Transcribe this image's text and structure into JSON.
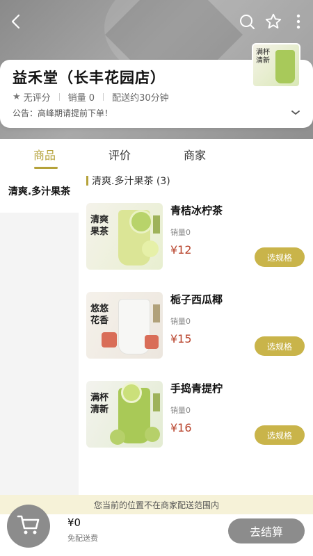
{
  "header": {
    "back_icon": "back-arrow-icon",
    "search_icon": "search-icon",
    "favorite_icon": "star-outline-icon",
    "more_icon": "more-vertical-icon",
    "logo_text": "满杯清新"
  },
  "store": {
    "name": "益禾堂（长丰花园店）",
    "rating": "无评分",
    "sales": "销量 0",
    "delivery_time": "配送约30分钟",
    "notice": "公告：高峰期请提前下单！"
  },
  "tabs": [
    {
      "label": "商品",
      "active": true
    },
    {
      "label": "评价",
      "active": false
    },
    {
      "label": "商家",
      "active": false
    }
  ],
  "sidebar": {
    "items": [
      {
        "label": "清爽.多汁果茶"
      }
    ]
  },
  "category": {
    "title": "清爽.多汁果茶 (3)"
  },
  "products": [
    {
      "name": "青桔冰柠茶",
      "sales": "销量0",
      "price": "¥12",
      "button": "选规格",
      "image_label": "清爽果茶",
      "cup_color": "#d9e58a"
    },
    {
      "name": "栀子西瓜椰",
      "sales": "销量0",
      "price": "¥15",
      "button": "选规格",
      "image_label": "悠悠花香",
      "cup_color": "#f1f1ef"
    },
    {
      "name": "手捣青提柠",
      "sales": "销量0",
      "price": "¥16",
      "button": "选规格",
      "image_label": "满杯清新",
      "cup_color": "#a9c957"
    }
  ],
  "bottom": {
    "delivery_notice": "您当前的位置不在商家配送范围内",
    "total": "¥0",
    "free_delivery": "免配送费",
    "checkout": "去结算",
    "cart_icon": "cart-icon"
  },
  "colors": {
    "accent": "#b5a23a",
    "price": "#b8432c",
    "spec_button": "#c9b44a",
    "disabled": "#8c8c8c"
  }
}
